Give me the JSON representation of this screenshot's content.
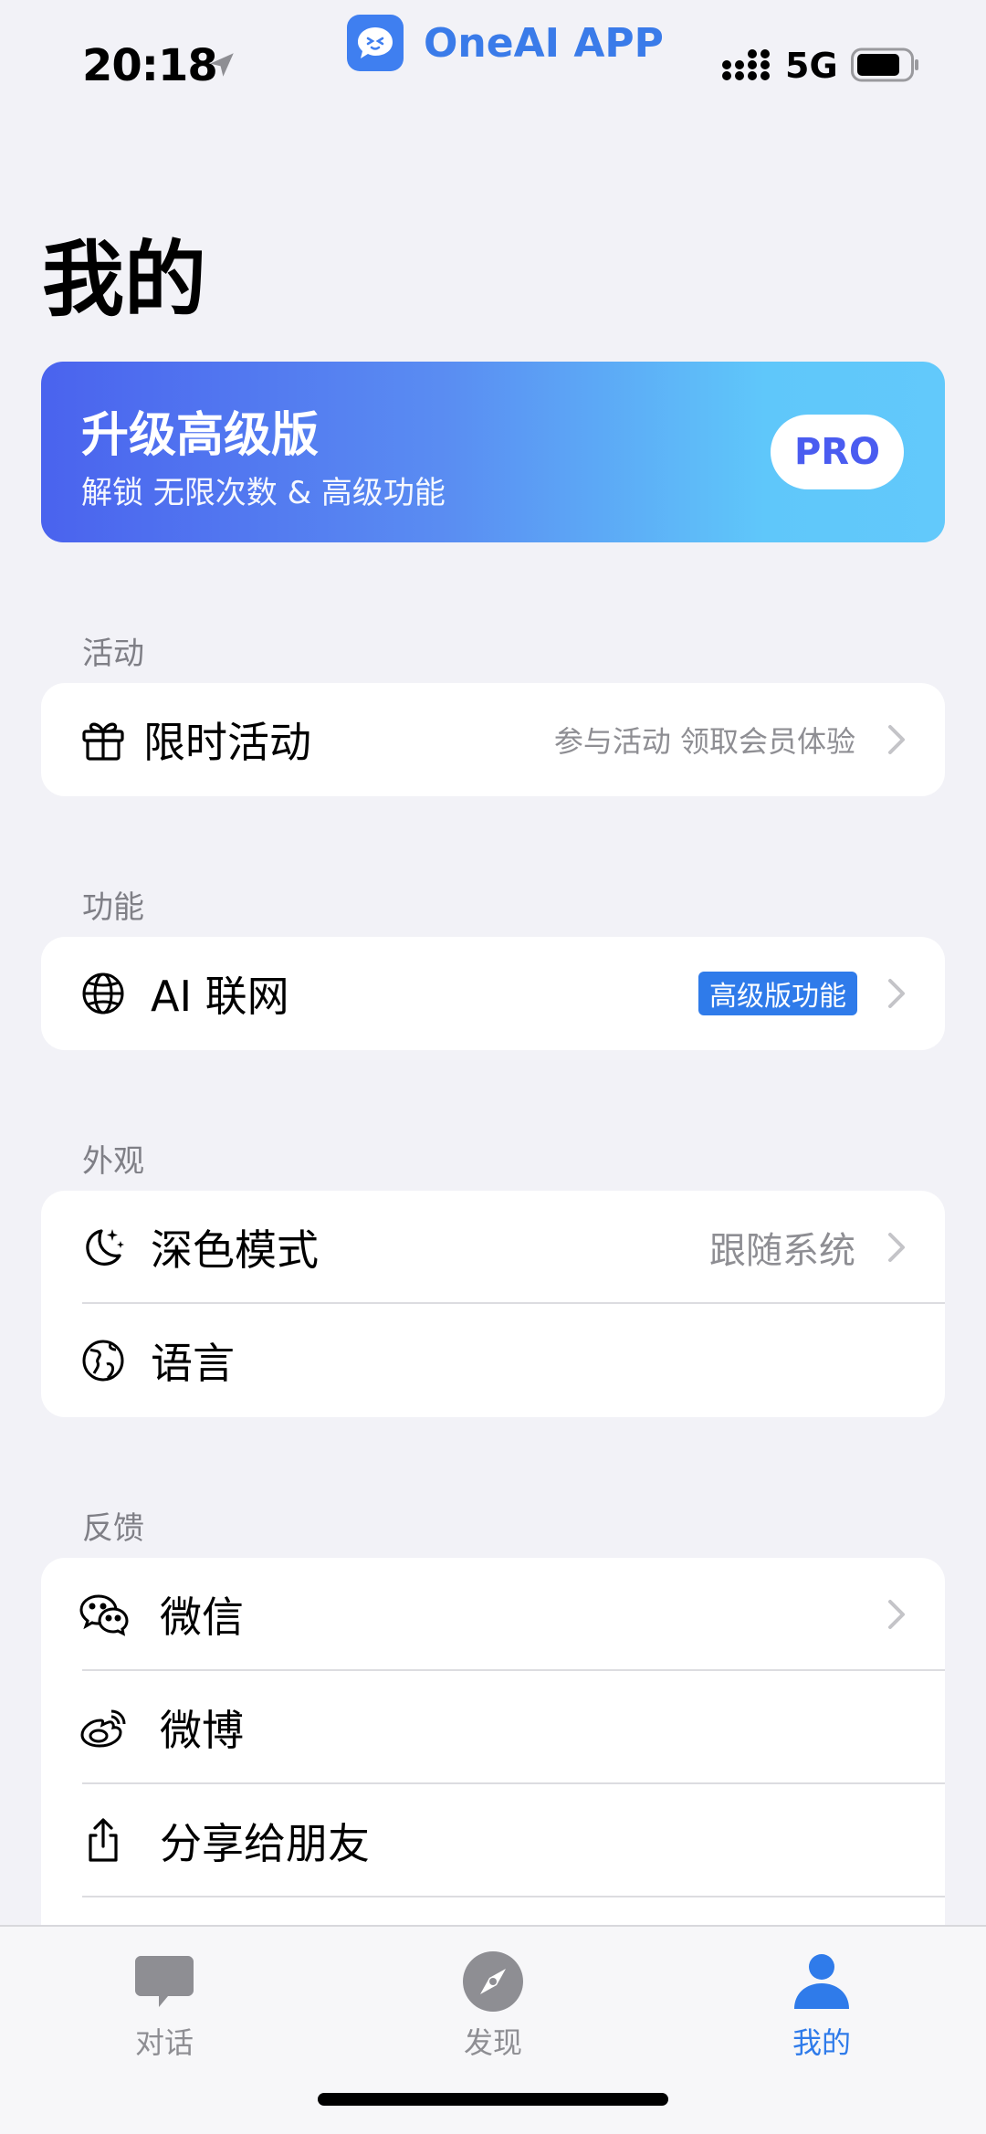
{
  "status_bar": {
    "time": "20:18",
    "app_name": "OneAI APP",
    "network": "5G"
  },
  "page": {
    "title": "我的"
  },
  "pro_banner": {
    "title": "升级高级版",
    "subtitle": "解锁 无限次数 & 高级功能",
    "badge": "PRO"
  },
  "sections": {
    "activity": {
      "label": "活动",
      "items": [
        {
          "icon": "gift-icon",
          "label": "限时活动",
          "value": "参与活动 领取会员体验"
        }
      ]
    },
    "features": {
      "label": "功能",
      "items": [
        {
          "icon": "globe-icon",
          "label": "AI 联网",
          "tag": "高级版功能"
        }
      ]
    },
    "appearance": {
      "label": "外观",
      "items": [
        {
          "icon": "moon-stars-icon",
          "label": "深色模式",
          "value": "跟随系统"
        },
        {
          "icon": "language-globe-icon",
          "label": "语言"
        }
      ]
    },
    "feedback": {
      "label": "反馈",
      "items": [
        {
          "icon": "wechat-icon",
          "label": "微信"
        },
        {
          "icon": "weibo-icon",
          "label": "微博"
        },
        {
          "icon": "share-icon",
          "label": "分享给朋友"
        }
      ]
    }
  },
  "tab_bar": {
    "tabs": [
      {
        "label": "对话",
        "icon": "chat-bubble-icon",
        "active": false
      },
      {
        "label": "发现",
        "icon": "compass-icon",
        "active": false
      },
      {
        "label": "我的",
        "icon": "person-icon",
        "active": true
      }
    ]
  },
  "colors": {
    "accent": "#2f7bea",
    "background": "#f2f2f7",
    "banner_start": "#4a63ee",
    "banner_end": "#62c9fb"
  }
}
